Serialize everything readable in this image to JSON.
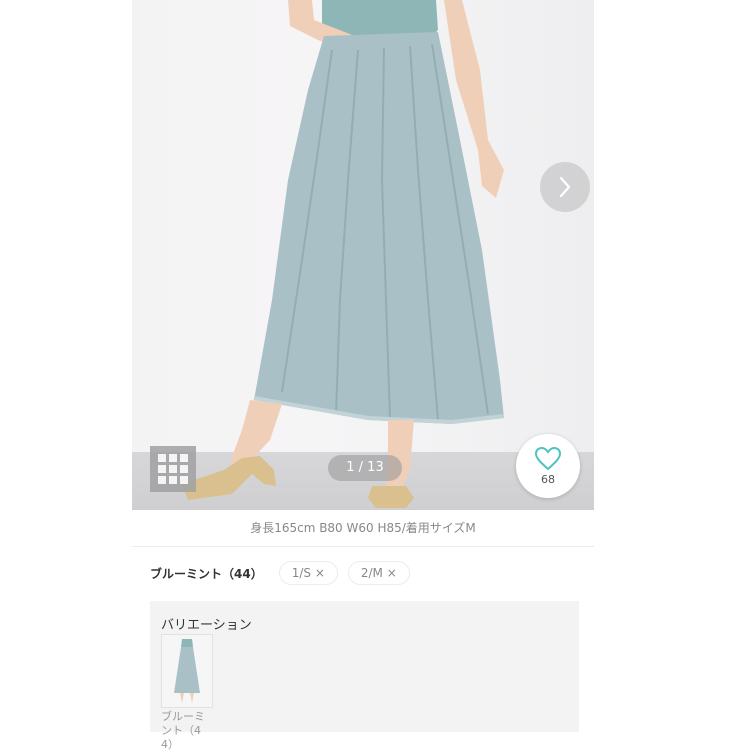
{
  "gallery": {
    "counter": "1 / 13",
    "favorite_count": "68",
    "icons": {
      "next": "chevron-right-icon",
      "grid": "grid-icon",
      "favorite": "heart-outline-icon"
    },
    "accent_color": "#4fc3c3"
  },
  "model_info": "身長165cm B80 W60 H85/着用サイズM",
  "selection": {
    "color_label": "ブルーミント（44）",
    "chips": [
      "1/S ×",
      "2/M ×"
    ]
  },
  "variation": {
    "title": "バリエーション",
    "items": [
      {
        "label": "ブルーミント（44）"
      }
    ]
  }
}
